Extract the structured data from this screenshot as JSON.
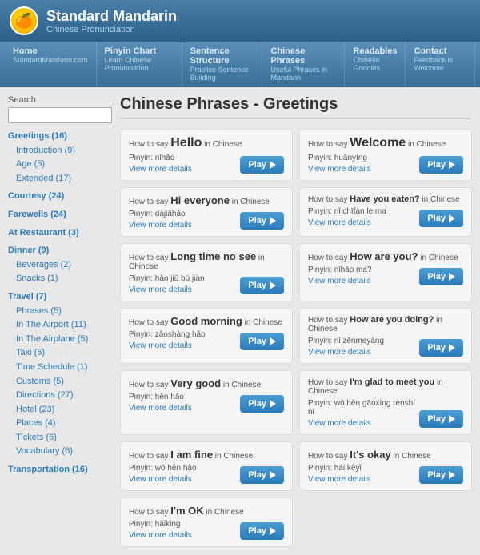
{
  "header": {
    "title": "Standard Mandarin",
    "subtitle": "Chinese Pronunciation",
    "logo_emoji": "🍊"
  },
  "nav": [
    {
      "label": "Home",
      "sub": "StandardMandarin.com"
    },
    {
      "label": "Pinyin Chart",
      "sub": "Learn Chinese Pronunciation"
    },
    {
      "label": "Sentence Structure",
      "sub": "Practice Sentence Building"
    },
    {
      "label": "Chinese Phrases",
      "sub": "Useful Phrases in Mandarin"
    },
    {
      "label": "Readables",
      "sub": "Chinese Goodies"
    },
    {
      "label": "Contact",
      "sub": "Feedback is Welcome"
    }
  ],
  "page_title": "Chinese Phrases - Greetings",
  "sidebar": {
    "search_label": "Search",
    "search_placeholder": "",
    "categories": [
      {
        "label": "Greetings (16)",
        "sub": true,
        "bold": true,
        "items": [
          {
            "label": "Introduction (9)"
          },
          {
            "label": "Age (5)"
          },
          {
            "label": "Extended (17)"
          }
        ]
      },
      {
        "label": "Courtesy (24)",
        "bold": true
      },
      {
        "label": "Farewells (24)",
        "bold": true
      },
      {
        "label": "At Restaurant (3)",
        "bold": true
      },
      {
        "label": "Dinner (9)",
        "bold": true,
        "items": [
          {
            "label": "Beverages (2)"
          },
          {
            "label": "Snacks (1)"
          }
        ]
      },
      {
        "label": "Travel (7)",
        "bold": true,
        "items": [
          {
            "label": "Phrases (5)"
          },
          {
            "label": "In The Airport (11)"
          },
          {
            "label": "In The Airplane (5)"
          },
          {
            "label": "Taxi (5)"
          },
          {
            "label": "Time Schedule (1)"
          },
          {
            "label": "Customs (5)"
          },
          {
            "label": "Directions (27)"
          },
          {
            "label": "Hotel (23)"
          },
          {
            "label": "Places (4)"
          },
          {
            "label": "Tickets (6)"
          },
          {
            "label": "Vocabulary (6)"
          }
        ]
      },
      {
        "label": "Transportation (16)",
        "bold": true
      }
    ]
  },
  "phrases": [
    {
      "how_to": "How to say",
      "word": "Hello",
      "word_size": "large",
      "in_chinese": "in Chinese",
      "pinyin": "nǐhǎo",
      "play_label": "Play"
    },
    {
      "how_to": "How to say",
      "word": "Welcome",
      "word_size": "large",
      "in_chinese": "in Chinese",
      "pinyin": "huānyíng",
      "play_label": "Play"
    },
    {
      "how_to": "How to say",
      "word": "Hi everyone",
      "word_size": "medium",
      "in_chinese": "in Chinese",
      "pinyin": "dàjiāhǎo",
      "play_label": "Play"
    },
    {
      "how_to": "How to say",
      "word": "Have you eaten?",
      "word_size": "small",
      "in_chinese": "in Chinese",
      "pinyin": "nǐ chīfàn le ma",
      "play_label": "Play"
    },
    {
      "how_to": "How to say",
      "word": "Long time no see",
      "word_size": "medium",
      "in_chinese": "in Chinese",
      "pinyin": "hǎo jiǔ bú jiàn",
      "play_label": "Play"
    },
    {
      "how_to": "How to say",
      "word": "How are you?",
      "word_size": "medium",
      "in_chinese": "in Chinese",
      "pinyin": "nǐhǎo ma?",
      "play_label": "Play"
    },
    {
      "how_to": "How to say",
      "word": "Good morning",
      "word_size": "medium",
      "in_chinese": "in Chinese",
      "pinyin": "zǎoshàng hǎo",
      "play_label": "Play"
    },
    {
      "how_to": "How to say",
      "word": "How are you doing?",
      "word_size": "small",
      "in_chinese": "in Chinese",
      "pinyin": "nǐ zěnmeyàng",
      "play_label": "Play"
    },
    {
      "how_to": "How to say",
      "word": "Very good",
      "word_size": "medium",
      "in_chinese": "in Chinese",
      "pinyin": "hěn hǎo",
      "play_label": "Play"
    },
    {
      "how_to": "How to say",
      "word": "I'm glad to meet you",
      "word_size": "small",
      "in_chinese": "in Chinese",
      "pinyin": "wǒ hěn gāoxìng rènshí nǐ",
      "play_label": "Play"
    },
    {
      "how_to": "How to say",
      "word": "I am fine",
      "word_size": "medium",
      "in_chinese": "in Chinese",
      "pinyin": "wǒ hěn hǎo",
      "play_label": "Play"
    },
    {
      "how_to": "How to say",
      "word": "It's okay",
      "word_size": "medium",
      "in_chinese": "in Chinese",
      "pinyin": "hái kěyǐ",
      "play_label": "Play"
    },
    {
      "how_to": "How to say",
      "word": "I'm OK",
      "word_size": "medium",
      "in_chinese": "in Chinese",
      "pinyin": "hǎiking",
      "play_label": "Play"
    }
  ],
  "view_more_label": "View more details",
  "colors": {
    "accent": "#2a7ab8",
    "header_bg": "#4a7fa8"
  }
}
